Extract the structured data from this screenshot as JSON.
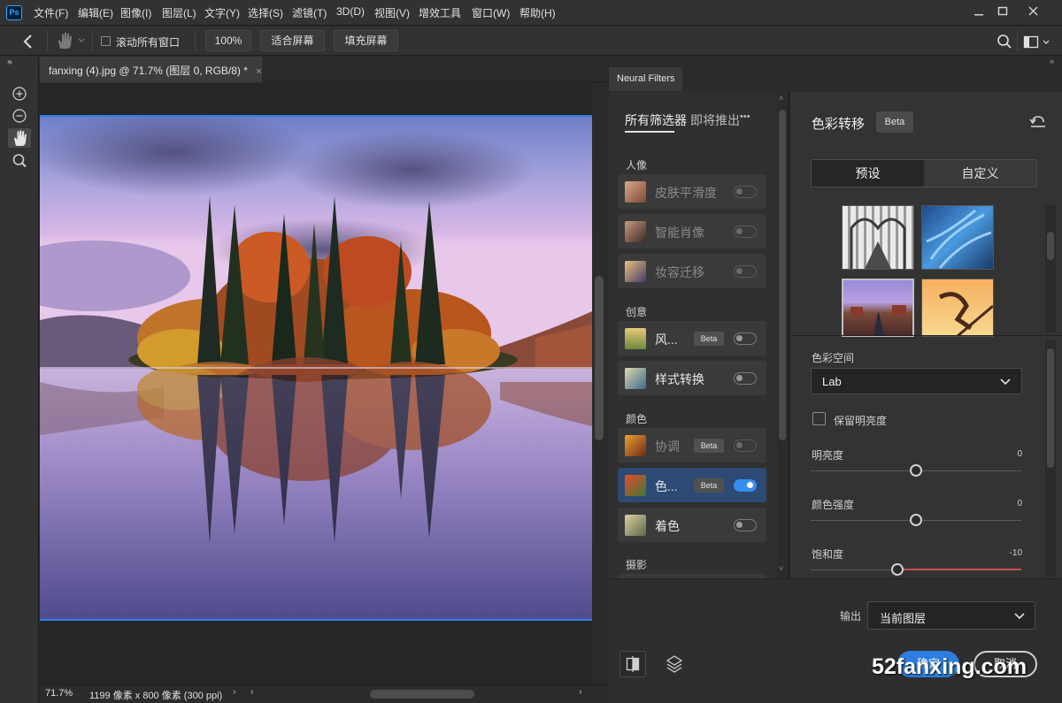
{
  "app": {
    "logo": "Ps"
  },
  "menu": [
    "文件(F)",
    "编辑(E)",
    "图像(I)",
    "图层(L)",
    "文字(Y)",
    "选择(S)",
    "滤镜(T)",
    "3D(D)",
    "视图(V)",
    "增效工具",
    "窗口(W)",
    "帮助(H)"
  ],
  "options": {
    "scroll_all_label": "滚动所有窗口",
    "zoom_value": "100%",
    "fit_screen": "适合屏幕",
    "fill_screen": "填充屏幕"
  },
  "document": {
    "tab_title": "fanxing (4).jpg @ 71.7% (图层 0, RGB/8) *",
    "zoom": "71.7%",
    "info": "1199 像素 x 800 像素 (300 ppi)"
  },
  "neural_filters": {
    "panel_tab": "Neural Filters",
    "category_tabs": {
      "all": "所有筛选器",
      "coming": "即将推出"
    },
    "sections": {
      "portrait": "人像",
      "creative": "创意",
      "color": "颜色",
      "photography": "摄影"
    },
    "filters": [
      {
        "label": "皮肤平滑度",
        "beta": "",
        "enabled": false,
        "disabled": true
      },
      {
        "label": "智能肖像",
        "beta": "",
        "enabled": false,
        "disabled": true
      },
      {
        "label": "妆容迁移",
        "beta": "",
        "enabled": false,
        "disabled": true
      },
      {
        "label": "风...",
        "beta": "Beta",
        "enabled": false,
        "disabled": false
      },
      {
        "label": "样式转换",
        "beta": "",
        "enabled": false,
        "disabled": false
      },
      {
        "label": "协调",
        "beta": "Beta",
        "enabled": false,
        "disabled": true
      },
      {
        "label": "色...",
        "beta": "Beta",
        "enabled": true,
        "disabled": false,
        "selected": true
      },
      {
        "label": "着色",
        "beta": "",
        "enabled": false,
        "disabled": false
      }
    ],
    "detail": {
      "title": "色彩转移",
      "beta": "Beta",
      "tab_preset": "预设",
      "tab_custom": "自定义",
      "color_space_label": "色彩空间",
      "color_space_value": "Lab",
      "preserve_luminance": "保留明亮度",
      "sliders": [
        {
          "label": "明亮度",
          "value": "0",
          "level": 0.5
        },
        {
          "label": "颜色强度",
          "value": "0",
          "level": 0.5
        },
        {
          "label": "饱和度",
          "value": "-10",
          "level": 0.41
        }
      ]
    },
    "footer": {
      "output_label": "输出",
      "output_value": "当前图层",
      "ok": "确定",
      "cancel": "取消"
    }
  },
  "watermark": "52fanxing.com"
}
